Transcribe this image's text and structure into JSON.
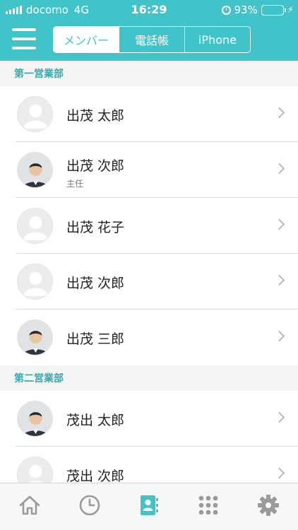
{
  "status_bar": {
    "carrier": "docomo",
    "network": "4G",
    "time": "16:29",
    "battery": "93%",
    "battery_level": 0.93,
    "battery_color": "#4cd964"
  },
  "header": {
    "background": "#40c4c9",
    "menu_icon": "hamburger-icon",
    "tabs": [
      {
        "label": "メンバー",
        "active": true
      },
      {
        "label": "電話帳",
        "active": false
      },
      {
        "label": "iPhone",
        "active": false
      }
    ]
  },
  "sections": [
    {
      "title": "第一営業部",
      "members": [
        {
          "name": "出茂 太郎",
          "subtitle": "",
          "avatar": "placeholder-avatar"
        },
        {
          "name": "出茂 次郎",
          "subtitle": "主任",
          "avatar": "photo-avatar"
        },
        {
          "name": "出茂 花子",
          "subtitle": "",
          "avatar": "placeholder-avatar"
        },
        {
          "name": "出茂 次郎",
          "subtitle": "",
          "avatar": "placeholder-avatar"
        },
        {
          "name": "出茂 三郎",
          "subtitle": "",
          "avatar": "photo-avatar"
        }
      ]
    },
    {
      "title": "第二営業部",
      "members": [
        {
          "name": "茂出 太郎",
          "subtitle": "",
          "avatar": "photo-avatar"
        },
        {
          "name": "茂出 次郎",
          "subtitle": "",
          "avatar": "placeholder-avatar"
        }
      ]
    }
  ],
  "tab_bar": {
    "items": [
      {
        "icon": "home-icon",
        "active": false
      },
      {
        "icon": "clock-icon",
        "active": false
      },
      {
        "icon": "contacts-icon",
        "active": true
      },
      {
        "icon": "keypad-icon",
        "active": false
      },
      {
        "icon": "gear-icon",
        "active": false
      }
    ],
    "active_color": "#40c4c9",
    "inactive_color": "#9a9a9a"
  }
}
